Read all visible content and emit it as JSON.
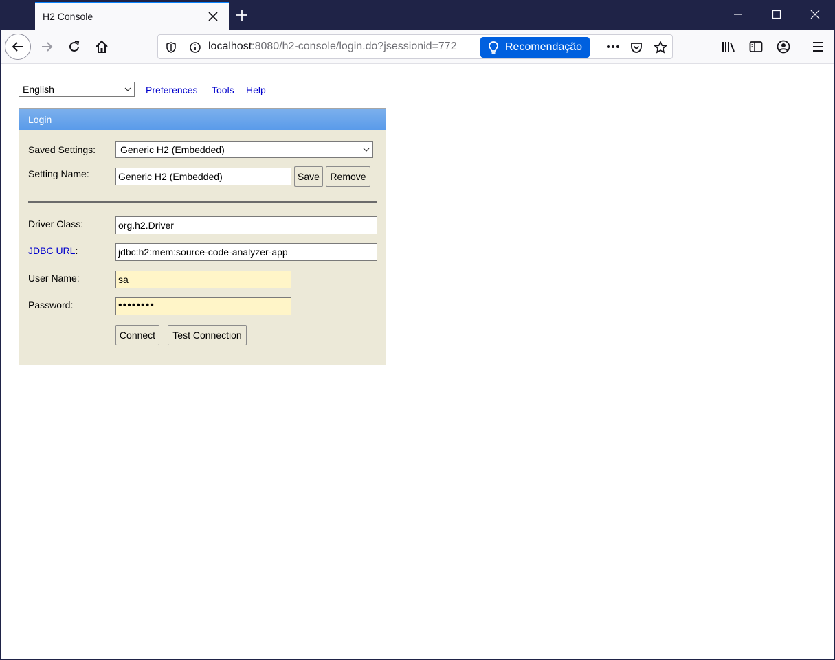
{
  "browser": {
    "tab_title": "H2 Console",
    "url_host": "localhost",
    "url_rest": ":8080/h2-console/login.do?jsessionid=772",
    "recommendation_label": "Recomendação",
    "accent_color": "#0060df"
  },
  "page": {
    "language": "English",
    "links": {
      "preferences": "Preferences",
      "tools": "Tools",
      "help": "Help"
    }
  },
  "login": {
    "header": "Login",
    "saved_settings_label": "Saved Settings:",
    "saved_settings_value": "Generic H2 (Embedded)",
    "setting_name_label": "Setting Name:",
    "setting_name_value": "Generic H2 (Embedded)",
    "save_label": "Save",
    "remove_label": "Remove",
    "driver_class_label": "Driver Class:",
    "driver_class_value": "org.h2.Driver",
    "jdbc_url_link": "JDBC URL",
    "jdbc_url_colon": ":",
    "jdbc_url_value": "jdbc:h2:mem:source-code-analyzer-app",
    "user_name_label": "User Name:",
    "user_name_value": "sa",
    "password_label": "Password:",
    "password_value": "••••••••",
    "connect_label": "Connect",
    "test_connection_label": "Test Connection"
  }
}
